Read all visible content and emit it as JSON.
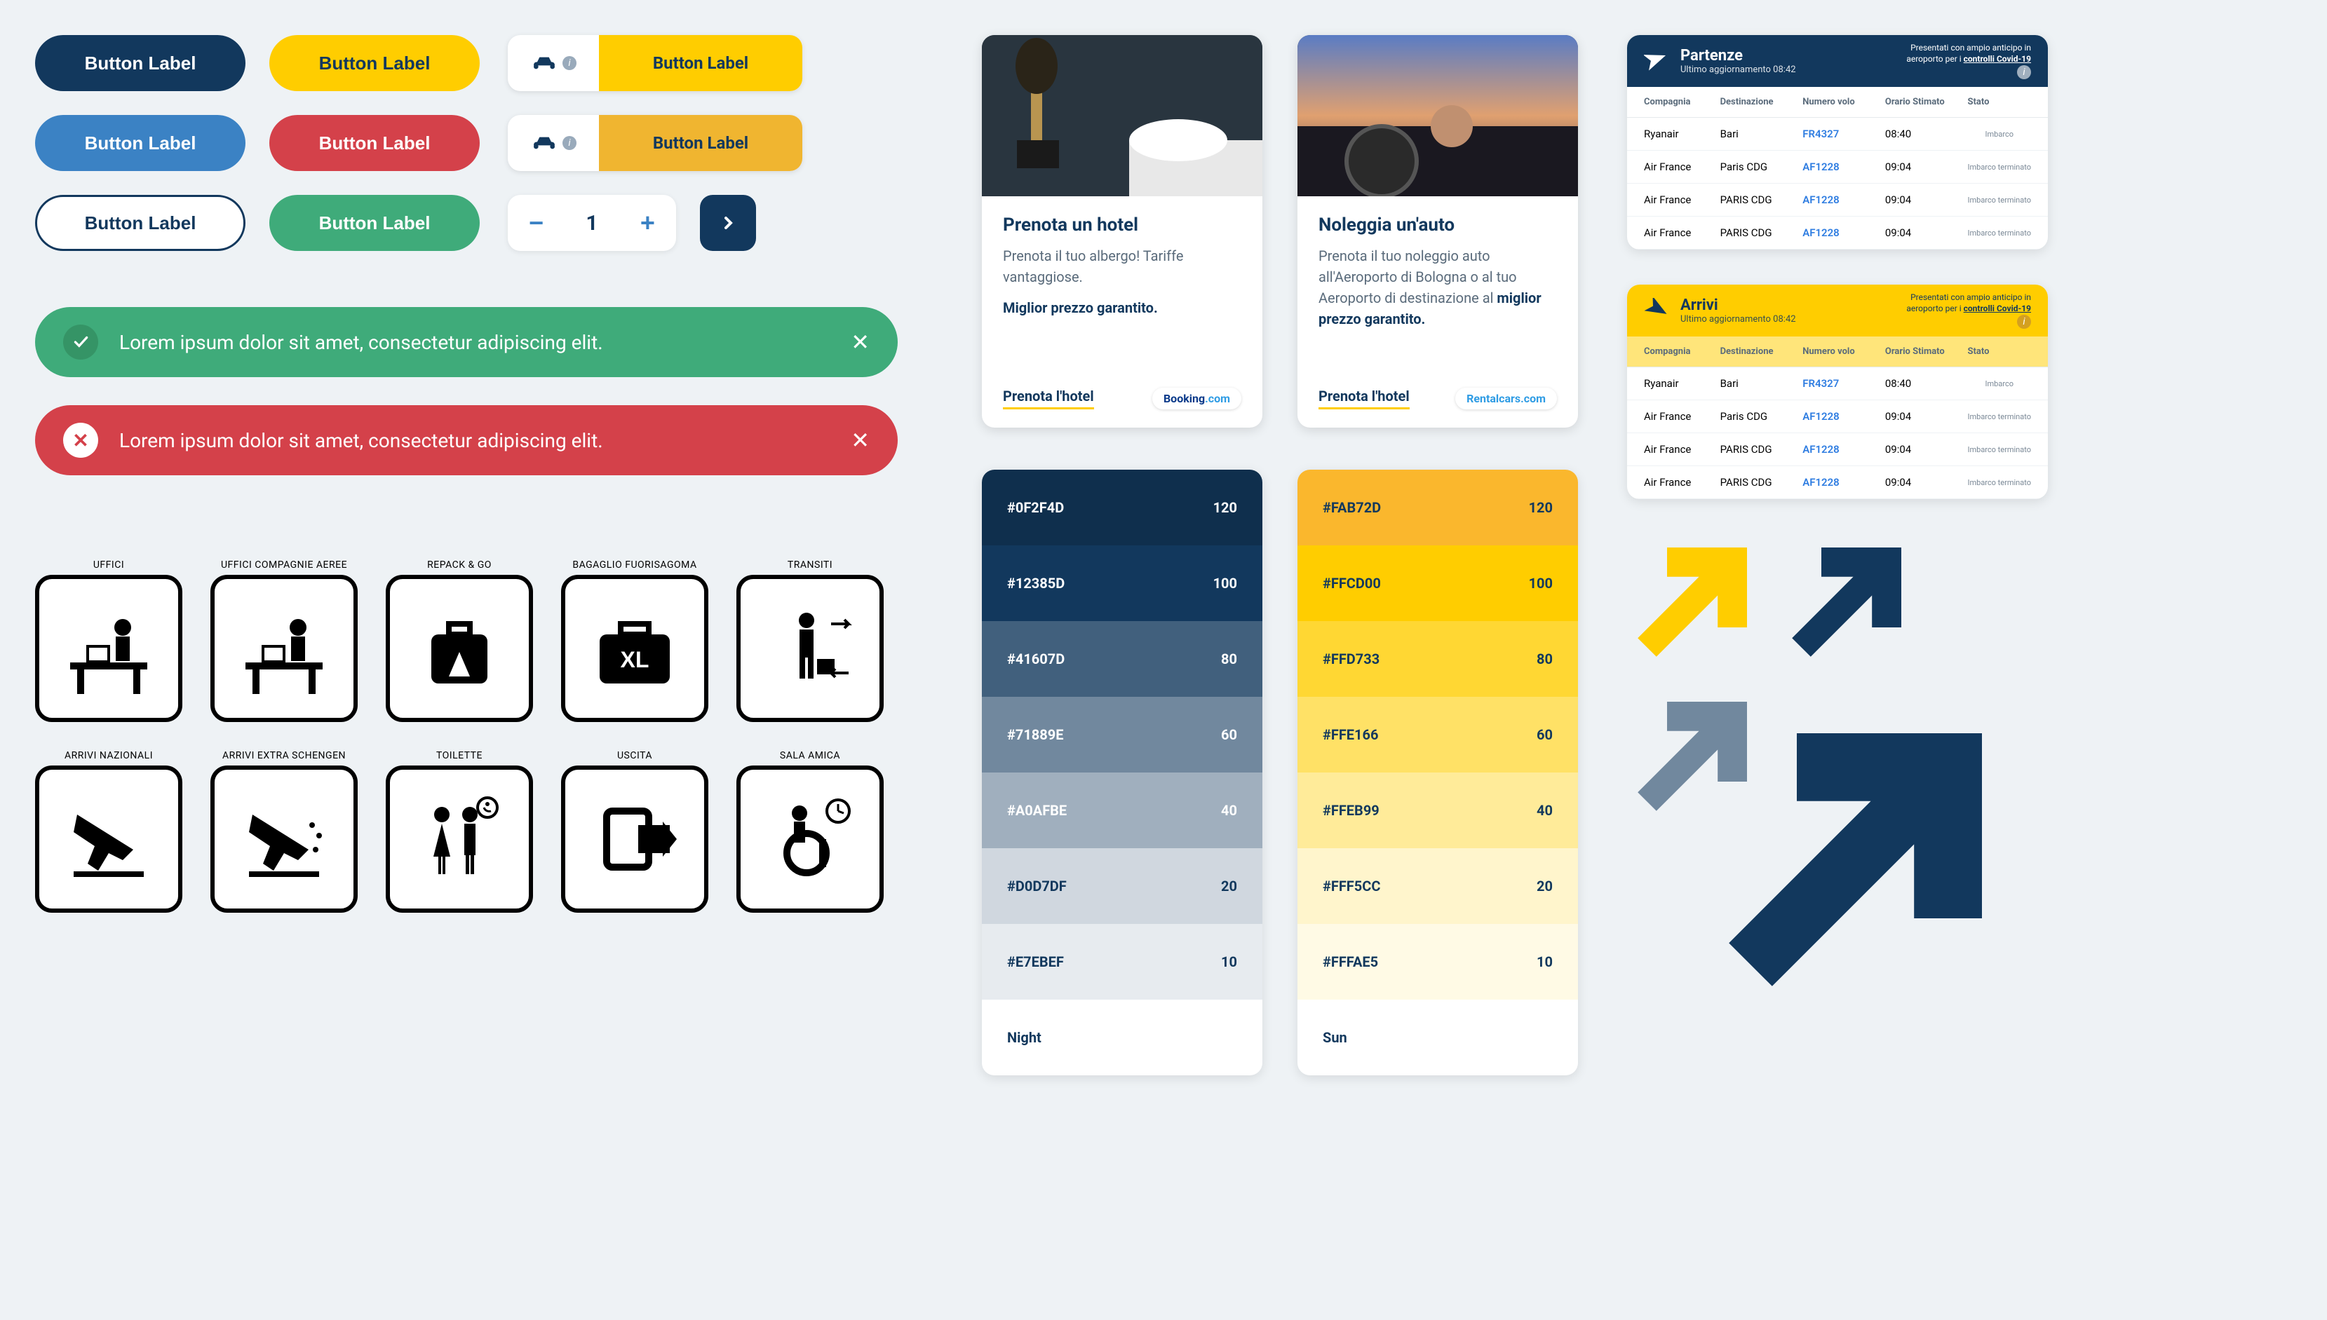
{
  "buttons": {
    "label": "Button Label",
    "stepper_value": "1"
  },
  "alerts": {
    "success": "Lorem ipsum dolor sit amet, consectetur adipiscing elit.",
    "error": "Lorem ipsum dolor sit amet, consectetur adipiscing elit."
  },
  "cards": {
    "hotel": {
      "title": "Prenota un hotel",
      "desc": "Prenota il tuo albergo! Tariffe vantaggiose.",
      "bold": "Miglior prezzo garantito.",
      "cta": "Prenota l'hotel",
      "partner_a": "Booking",
      "partner_b": ".com"
    },
    "car": {
      "title": "Noleggia un'auto",
      "desc": "Prenota il tuo noleggio auto all'Aeroporto di Bologna o al tuo Aeroporto di destinazione al",
      "bold": "miglior prezzo garantito.",
      "cta": "Prenota l'hotel",
      "partner": "Rentalcars.com"
    }
  },
  "palettes": {
    "night": [
      {
        "hex": "#0F2F4D",
        "val": "120",
        "fg": "#fff"
      },
      {
        "hex": "#12385D",
        "val": "100",
        "fg": "#fff"
      },
      {
        "hex": "#41607D",
        "val": "80",
        "fg": "#fff"
      },
      {
        "hex": "#71889E",
        "val": "60",
        "fg": "#fff"
      },
      {
        "hex": "#A0AFBE",
        "val": "40",
        "fg": "#fff"
      },
      {
        "hex": "#D0D7DF",
        "val": "20",
        "fg": "#12385d"
      },
      {
        "hex": "#E7EBEF",
        "val": "10",
        "fg": "#12385d"
      }
    ],
    "night_label": "Night",
    "sun": [
      {
        "hex": "#FAB72D",
        "val": "120",
        "fg": "#12385d"
      },
      {
        "hex": "#FFCD00",
        "val": "100",
        "fg": "#12385d"
      },
      {
        "hex": "#FFD733",
        "val": "80",
        "fg": "#12385d"
      },
      {
        "hex": "#FFE166",
        "val": "60",
        "fg": "#12385d"
      },
      {
        "hex": "#FFEB99",
        "val": "40",
        "fg": "#12385d"
      },
      {
        "hex": "#FFF5CC",
        "val": "20",
        "fg": "#12385d"
      },
      {
        "hex": "#FFFAE5",
        "val": "10",
        "fg": "#12385d"
      }
    ],
    "sun_label": "Sun"
  },
  "pictograms": [
    {
      "label": "UFFICI",
      "key": "desk"
    },
    {
      "label": "UFFICI COMPAGNIE AEREE",
      "key": "desk2"
    },
    {
      "label": "REPACK & GO",
      "key": "bag"
    },
    {
      "label": "BAGAGLIO FUORISAGOMA",
      "key": "xl"
    },
    {
      "label": "TRANSITI",
      "key": "transit"
    },
    {
      "label": "ARRIVI NAZIONALI",
      "key": "arr1"
    },
    {
      "label": "ARRIVI EXTRA SCHENGEN",
      "key": "arr2"
    },
    {
      "label": "TOILETTE",
      "key": "wc"
    },
    {
      "label": "USCITA",
      "key": "exit"
    },
    {
      "label": "SALA AMICA",
      "key": "wheel"
    }
  ],
  "boards": {
    "dep": {
      "title": "Partenze",
      "sub": "Ultimo aggiornamento 08:42",
      "notice_a": "Presentati con ampio anticipo in aeroporto per i ",
      "notice_b": "controlli Covid-19",
      "columns": [
        "Compagnia",
        "Destinazione",
        "Numero volo",
        "Orario Stimato",
        "Stato"
      ],
      "rows": [
        {
          "c": "Ryanair",
          "d": "Bari",
          "n": "FR4327",
          "t": "08:40",
          "s": "Imbarco"
        },
        {
          "c": "Air France",
          "d": "Paris CDG",
          "n": "AF1228",
          "t": "09:04",
          "s": "Imbarco terminato"
        },
        {
          "c": "Air France",
          "d": "PARIS CDG",
          "n": "AF1228",
          "t": "09:04",
          "s": "Imbarco terminato"
        },
        {
          "c": "Air France",
          "d": "PARIS CDG",
          "n": "AF1228",
          "t": "09:04",
          "s": "Imbarco terminato"
        }
      ]
    },
    "arr": {
      "title": "Arrivi",
      "sub": "Ultimo aggiornamento 08:42",
      "notice_a": "Presentati con ampio anticipo in aeroporto per i ",
      "notice_b": "controlli Covid-19",
      "columns": [
        "Compagnia",
        "Destinazione",
        "Numero volo",
        "Orario Stimato",
        "Stato"
      ],
      "rows": [
        {
          "c": "Ryanair",
          "d": "Bari",
          "n": "FR4327",
          "t": "08:40",
          "s": "Imbarco"
        },
        {
          "c": "Air France",
          "d": "Paris CDG",
          "n": "AF1228",
          "t": "09:04",
          "s": "Imbarco terminato"
        },
        {
          "c": "Air France",
          "d": "PARIS CDG",
          "n": "AF1228",
          "t": "09:04",
          "s": "Imbarco terminato"
        },
        {
          "c": "Air France",
          "d": "PARIS CDG",
          "n": "AF1228",
          "t": "09:04",
          "s": "Imbarco terminato"
        }
      ]
    }
  },
  "arrow_colors": {
    "yellow": "#ffcd00",
    "navy": "#12385d",
    "grey": "#71889e"
  }
}
